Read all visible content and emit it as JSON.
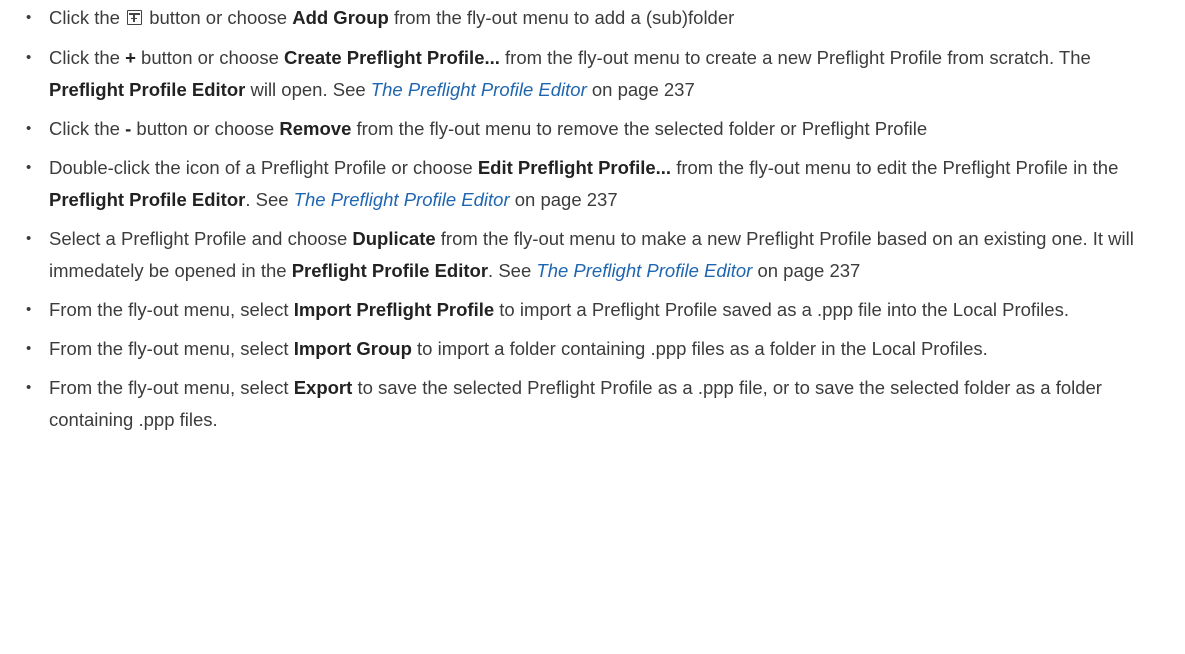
{
  "items": [
    {
      "a": "Click the",
      "icon": "add-group-icon",
      "b": "button or choose",
      "c": "Add Group",
      "d": "from the fly-out menu to add a (sub)folder"
    },
    {
      "a": "Click the",
      "b": "+",
      "c": "button or choose",
      "d": "Create Preflight Profile...",
      "e": "from the fly-out menu to create a new Preflight Profile from scratch. The",
      "f": "Preflight Profile Editor",
      "g": "will open. See",
      "h": "The Preflight Profile Editor",
      "i": "on page 237"
    },
    {
      "a": "Click the",
      "b": "-",
      "c": "button or choose",
      "d": "Remove",
      "e": "from the fly-out menu to remove the selected folder or Preflight Profile"
    },
    {
      "a": "Double-click the icon of a Preflight Profile or choose",
      "b": "Edit Preflight Profile...",
      "c": "from the fly-out menu to edit the Preflight Profile in the",
      "d": "Preflight Profile Editor",
      "e": ". See",
      "f": "The Preflight Profile Editor",
      "g": "on page 237"
    },
    {
      "a": "Select a Preflight Profile and choose",
      "b": "Duplicate",
      "c": "from the fly-out menu to make a new Preflight Profile based on an existing one. It will immedately be opened in the",
      "d": "Preflight Profile Editor",
      "e": ". See",
      "f": "The Preflight Profile Editor",
      "g": "on page 237"
    },
    {
      "a": "From the fly-out menu, select",
      "b": "Import Preflight Profile",
      "c": "to import a Preflight Profile saved as a .ppp file into the Local Profiles."
    },
    {
      "a": "From the fly-out menu, select",
      "b": "Import Group",
      "c": "to import a folder containing .ppp files as a folder in the Local Profiles."
    },
    {
      "a": "From the fly-out menu, select",
      "b": "Export",
      "c": "to save the selected Preflight Profile as a .ppp file, or to save the selected folder as a folder containing .ppp files."
    }
  ]
}
